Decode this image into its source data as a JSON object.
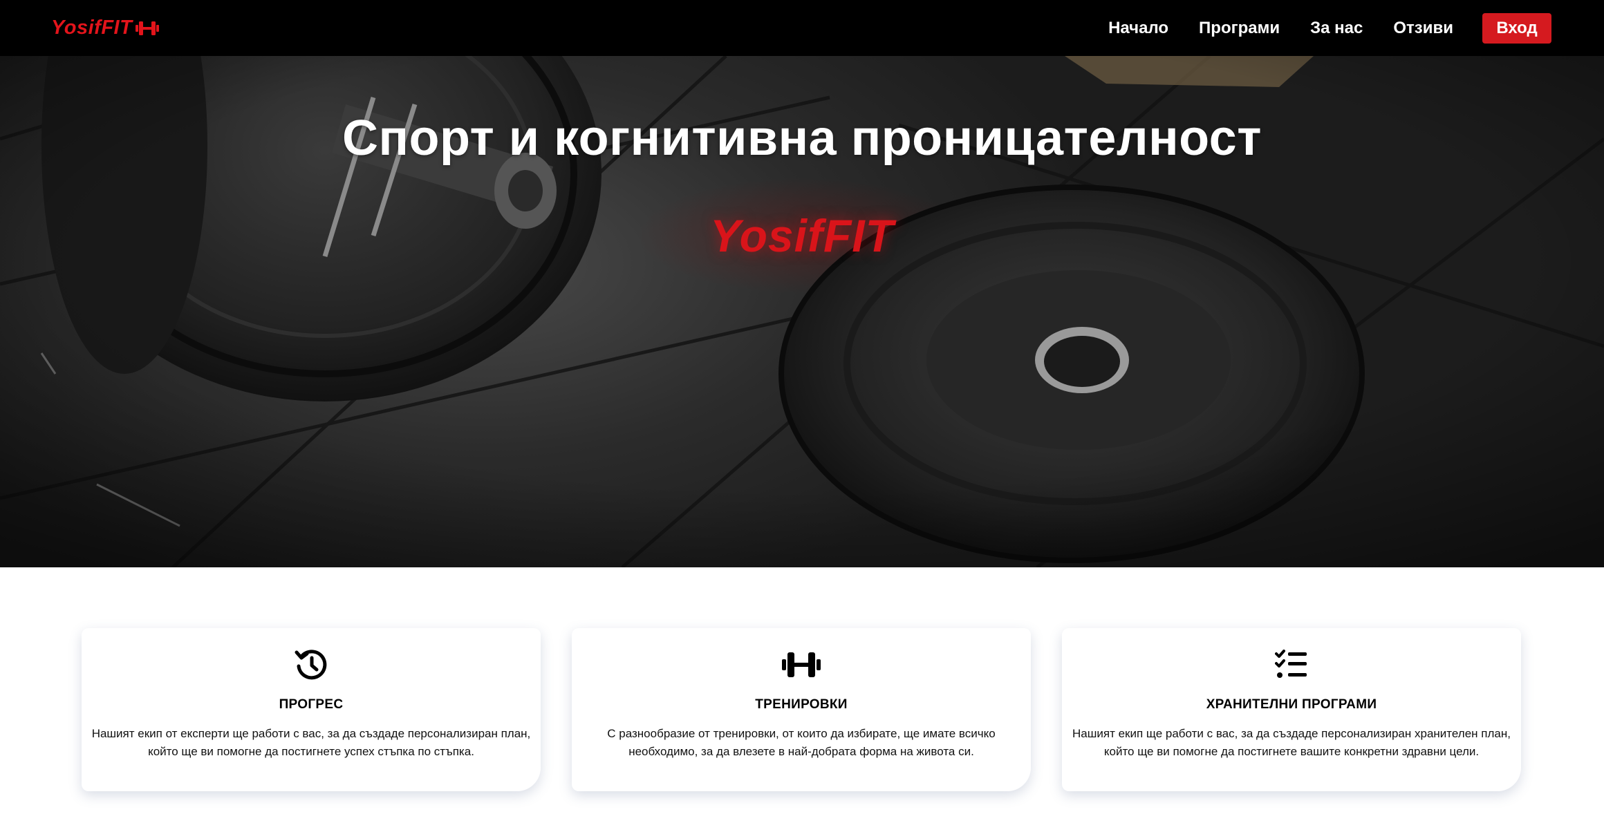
{
  "nav": {
    "brand": "YosifFIT",
    "brand_icon": "dumbbell-icon",
    "links": [
      {
        "label": "Начало"
      },
      {
        "label": "Програми"
      },
      {
        "label": "За нас"
      },
      {
        "label": "Отзиви"
      }
    ],
    "login_label": "Вход"
  },
  "hero": {
    "title": "Спорт и когнитивна проницателност",
    "logo_text": "YosifFIT"
  },
  "features": [
    {
      "icon": "history-clock-icon",
      "title": "ПРОГРЕС",
      "text": "Нашият екип от експерти ще работи с вас, за да създаде персонализиран план, който ще ви помогне да постигнете успех стъпка по стъпка."
    },
    {
      "icon": "dumbbell-icon",
      "title": "ТРЕНИРОВКИ",
      "text": "С разнообразие от тренировки, от които да избирате, ще имате всичко необходимо, за да влезете в най-добрата форма на живота си."
    },
    {
      "icon": "checklist-icon",
      "title": "ХРАНИТЕЛНИ ПРОГРАМИ",
      "text": "Нашият екип ще работи с вас, за да създаде персонализиран хранителен план, който ще ви помогне да постигнете вашите конкретни здравни цели."
    }
  ],
  "colors": {
    "accent": "#d51a1f",
    "navbar": "#000000"
  }
}
